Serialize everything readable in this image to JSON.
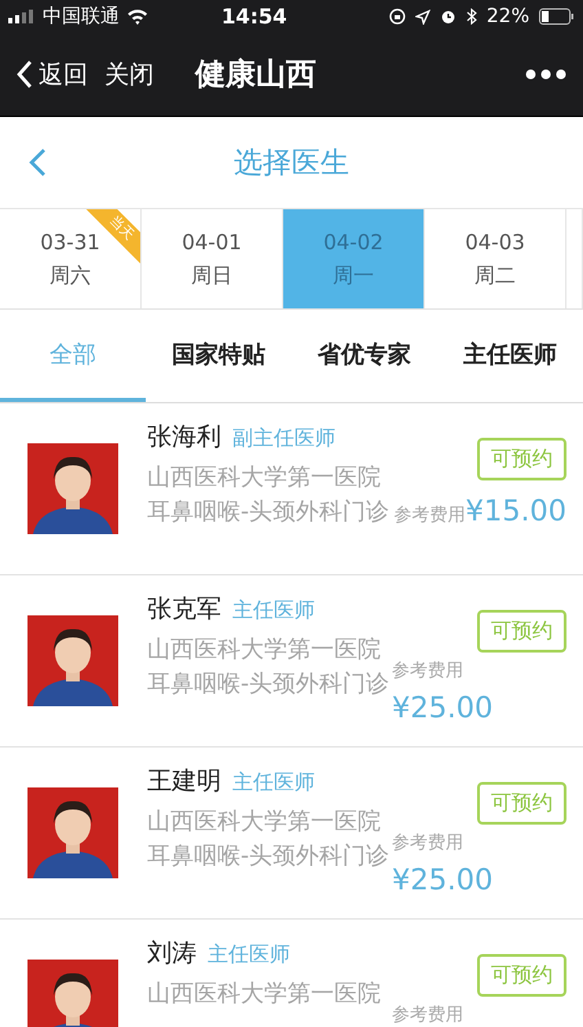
{
  "status_bar": {
    "carrier": "中国联通",
    "time": "14:54",
    "battery": "22%"
  },
  "nav": {
    "back": "返回",
    "close": "关闭",
    "title": "健康山西"
  },
  "header": {
    "title": "选择医生"
  },
  "dates": [
    {
      "date": "03-31",
      "weekday": "周六",
      "selected": false,
      "badge": "当天"
    },
    {
      "date": "04-01",
      "weekday": "周日",
      "selected": false
    },
    {
      "date": "04-02",
      "weekday": "周一",
      "selected": true
    },
    {
      "date": "04-03",
      "weekday": "周二",
      "selected": false
    }
  ],
  "tabs": [
    {
      "label": "全部",
      "selected": true
    },
    {
      "label": "国家特贴",
      "selected": false
    },
    {
      "label": "省优专家",
      "selected": false
    },
    {
      "label": "主任医师",
      "selected": false
    }
  ],
  "doctors": [
    {
      "name": "张海利",
      "title": "副主任医师",
      "hospital": "山西医科大学第一医院",
      "department": "耳鼻咽喉-头颈外科门诊",
      "status": "可预约",
      "fee_label": "参考费用",
      "fee": "¥15.00",
      "kind": "inline"
    },
    {
      "name": "张克军",
      "title": "主任医师",
      "hospital": "山西医科大学第一医院",
      "department": "耳鼻咽喉-头颈外科门诊",
      "status": "可预约",
      "fee_label": "参考费用",
      "fee": "¥25.00",
      "kind": "stacked"
    },
    {
      "name": "王建明",
      "title": "主任医师",
      "hospital": "山西医科大学第一医院",
      "department": "耳鼻咽喉-头颈外科门诊",
      "status": "可预约",
      "fee_label": "参考费用",
      "fee": "¥25.00",
      "kind": "stacked"
    },
    {
      "name": "刘涛",
      "title": "主任医师",
      "hospital": "山西医科大学第一医院",
      "status": "可预约",
      "fee_label": "参考费用",
      "kind": "stacked"
    }
  ]
}
